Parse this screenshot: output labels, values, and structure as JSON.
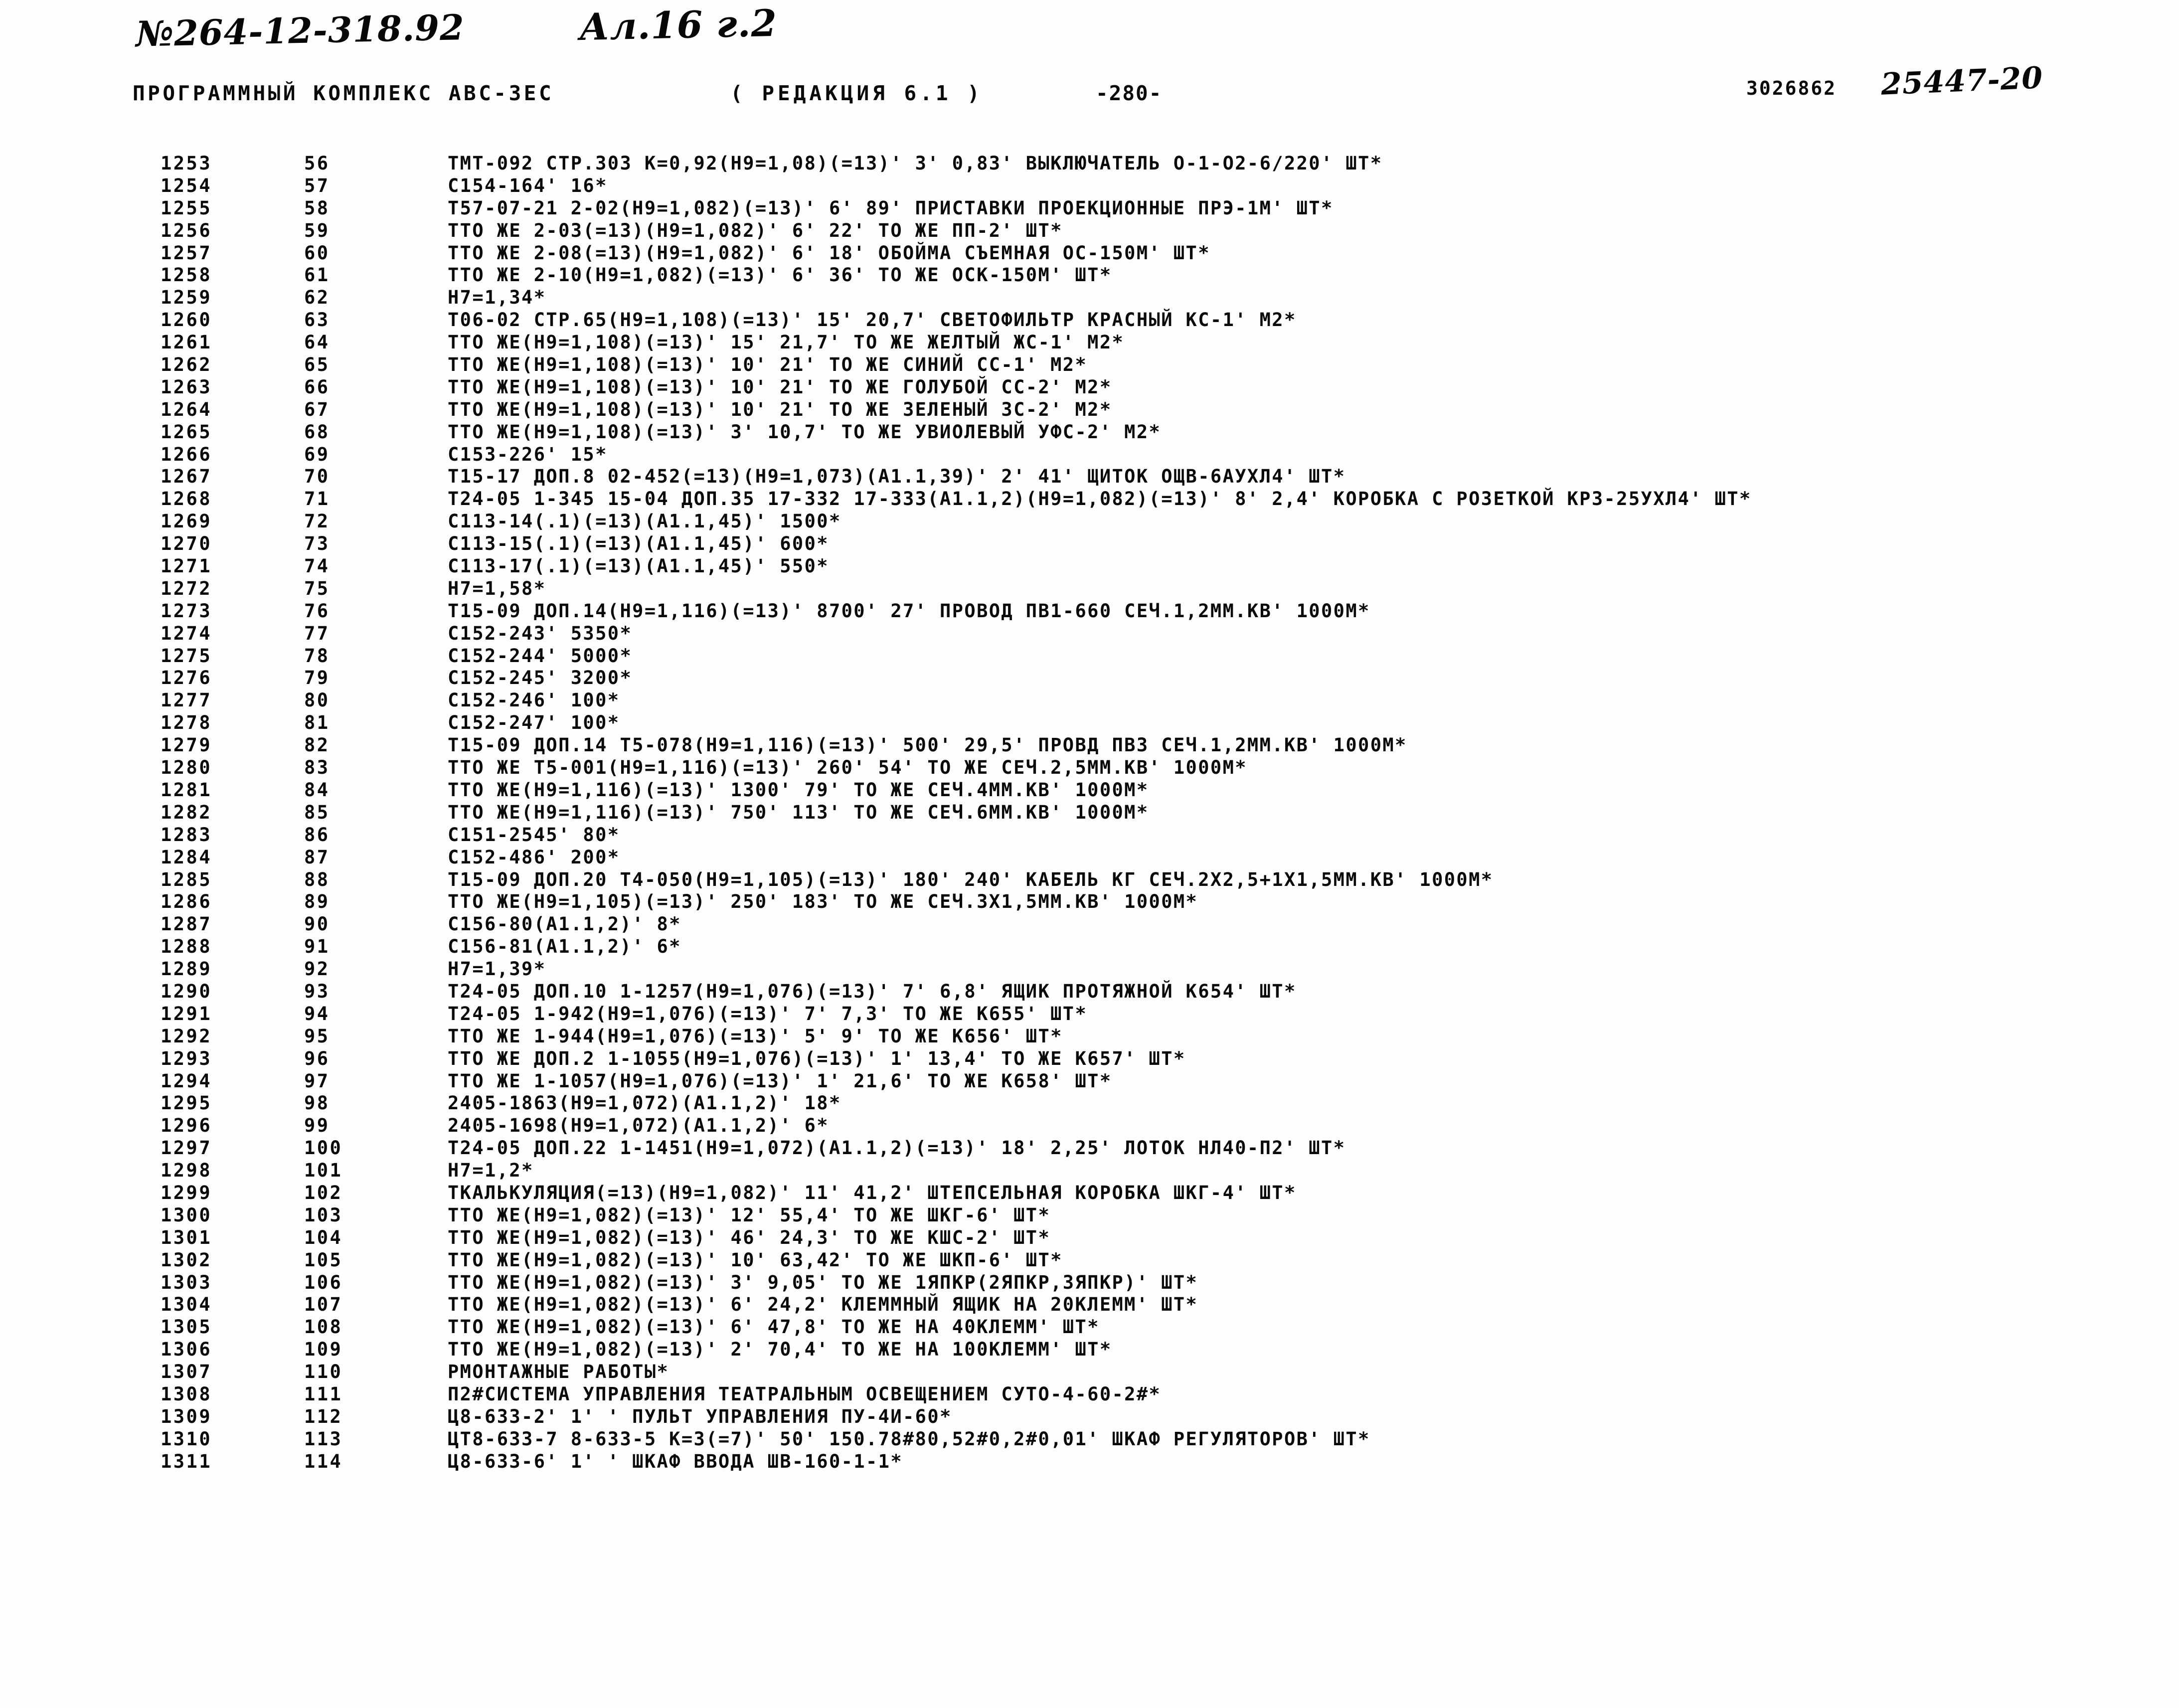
{
  "annotations": {
    "doc_number": "№264-12-318.92",
    "album_ref": "Ал.16 г.2",
    "archive_number": "25447-20"
  },
  "header": {
    "complex_title": "ПРОГРАММНЫЙ КОМПЛЕКС АВС-3ЕС",
    "revision": "( РЕДАКЦИЯ  6.1 )",
    "page_number": "-280-",
    "doc_code": "3026862"
  },
  "listing": {
    "columns": [
      "seq",
      "idx",
      "text"
    ],
    "rows": [
      [
        "1253",
        "56",
        "ТМТ-092 СТР.303 К=0,92(Н9=1,08)(=13)' 3' 0,83' ВЫКЛЮЧАТЕЛЬ О-1-О2-6/220' ШТ*"
      ],
      [
        "1254",
        "57",
        "С154-164' 16*"
      ],
      [
        "1255",
        "58",
        "Т57-07-21 2-02(Н9=1,082)(=13)' 6' 89' ПРИСТАВКИ ПРОЕКЦИОННЫЕ ПРЭ-1М' ШТ*"
      ],
      [
        "1256",
        "59",
        "ТТО ЖЕ 2-03(=13)(Н9=1,082)' 6' 22' ТО ЖЕ ПП-2' ШТ*"
      ],
      [
        "1257",
        "60",
        "ТТО ЖЕ 2-08(=13)(Н9=1,082)' 6' 18' ОБОЙМА СЪЕМНАЯ ОС-150М' ШТ*"
      ],
      [
        "1258",
        "61",
        "ТТО ЖЕ 2-10(Н9=1,082)(=13)' 6' 36' ТО ЖЕ ОСК-150М' ШТ*"
      ],
      [
        "1259",
        "62",
        "Н7=1,34*"
      ],
      [
        "1260",
        "63",
        "Т06-02 СТР.65(Н9=1,108)(=13)' 15' 20,7' СВЕТОФИЛЬТР КРАСНЫЙ КС-1' М2*"
      ],
      [
        "1261",
        "64",
        "ТТО ЖЕ(Н9=1,108)(=13)' 15' 21,7' ТО ЖЕ ЖЕЛТЫЙ ЖС-1' М2*"
      ],
      [
        "1262",
        "65",
        "ТТО ЖЕ(Н9=1,108)(=13)' 10' 21' ТО ЖЕ СИНИЙ СС-1' М2*"
      ],
      [
        "1263",
        "66",
        "ТТО ЖЕ(Н9=1,108)(=13)' 10' 21' ТО ЖЕ ГОЛУБОЙ СС-2' М2*"
      ],
      [
        "1264",
        "67",
        "ТТО ЖЕ(Н9=1,108)(=13)' 10' 21' ТО ЖЕ ЗЕЛЕНЫЙ ЗС-2' М2*"
      ],
      [
        "1265",
        "68",
        "ТТО ЖЕ(Н9=1,108)(=13)' 3' 10,7' ТО ЖЕ УВИОЛЕВЫЙ УФС-2' М2*"
      ],
      [
        "1266",
        "69",
        "С153-226' 15*"
      ],
      [
        "1267",
        "70",
        "Т15-17 ДОП.8 02-452(=13)(Н9=1,073)(А1.1,39)' 2' 41' ЩИТОК ОЩВ-6АУХЛ4' ШТ*"
      ],
      [
        "1268",
        "71",
        "Т24-05 1-345 15-04 ДОП.35 17-332 17-333(А1.1,2)(Н9=1,082)(=13)' 8' 2,4' КОРОБКА С РОЗЕТКОЙ КРЗ-25УХЛ4' ШТ*"
      ],
      [
        "1269",
        "72",
        "С113-14(.1)(=13)(А1.1,45)' 1500*"
      ],
      [
        "1270",
        "73",
        "С113-15(.1)(=13)(А1.1,45)' 600*"
      ],
      [
        "1271",
        "74",
        "С113-17(.1)(=13)(А1.1,45)' 550*"
      ],
      [
        "1272",
        "75",
        "Н7=1,58*"
      ],
      [
        "1273",
        "76",
        "Т15-09 ДОП.14(Н9=1,116)(=13)' 8700' 27' ПРОВОД ПВ1-660 СЕЧ.1,2ММ.КВ' 1000М*"
      ],
      [
        "1274",
        "77",
        "С152-243' 5350*"
      ],
      [
        "1275",
        "78",
        "С152-244' 5000*"
      ],
      [
        "1276",
        "79",
        "С152-245' 3200*"
      ],
      [
        "1277",
        "80",
        "С152-246' 100*"
      ],
      [
        "1278",
        "81",
        "С152-247' 100*"
      ],
      [
        "1279",
        "82",
        "Т15-09 ДОП.14 Т5-078(Н9=1,116)(=13)' 500' 29,5' ПРОВД ПВ3 СЕЧ.1,2ММ.КВ' 1000М*"
      ],
      [
        "1280",
        "83",
        "ТТО ЖЕ Т5-001(Н9=1,116)(=13)' 260' 54' ТО ЖЕ СЕЧ.2,5ММ.КВ' 1000М*"
      ],
      [
        "1281",
        "84",
        "ТТО ЖЕ(Н9=1,116)(=13)' 1300' 79' ТО ЖЕ СЕЧ.4ММ.КВ' 1000М*"
      ],
      [
        "1282",
        "85",
        "ТТО ЖЕ(Н9=1,116)(=13)' 750' 113' ТО ЖЕ СЕЧ.6ММ.КВ' 1000М*"
      ],
      [
        "1283",
        "86",
        "С151-2545' 80*"
      ],
      [
        "1284",
        "87",
        "С152-486' 200*"
      ],
      [
        "1285",
        "88",
        "Т15-09 ДОП.20 Т4-050(Н9=1,105)(=13)' 180' 240' КАБЕЛЬ КГ СЕЧ.2Х2,5+1Х1,5ММ.КВ' 1000М*"
      ],
      [
        "1286",
        "89",
        "ТТО ЖЕ(Н9=1,105)(=13)' 250' 183' ТО ЖЕ СЕЧ.3Х1,5ММ.КВ' 1000М*"
      ],
      [
        "1287",
        "90",
        "С156-80(А1.1,2)' 8*"
      ],
      [
        "1288",
        "91",
        "С156-81(А1.1,2)' 6*"
      ],
      [
        "1289",
        "92",
        "Н7=1,39*"
      ],
      [
        "1290",
        "93",
        "Т24-05 ДОП.10 1-1257(Н9=1,076)(=13)' 7' 6,8' ЯЩИК ПРОТЯЖНОЙ К654' ШТ*"
      ],
      [
        "1291",
        "94",
        "Т24-05 1-942(Н9=1,076)(=13)' 7' 7,3' ТО ЖЕ К655' ШТ*"
      ],
      [
        "1292",
        "95",
        "ТТО ЖЕ 1-944(Н9=1,076)(=13)' 5' 9' ТО ЖЕ К656' ШТ*"
      ],
      [
        "1293",
        "96",
        "ТТО ЖЕ ДОП.2 1-1055(Н9=1,076)(=13)' 1' 13,4' ТО ЖЕ К657' ШТ*"
      ],
      [
        "1294",
        "97",
        "ТТО ЖЕ 1-1057(Н9=1,076)(=13)' 1' 21,6' ТО ЖЕ К658' ШТ*"
      ],
      [
        "1295",
        "98",
        "2405-1863(Н9=1,072)(А1.1,2)' 18*"
      ],
      [
        "1296",
        "99",
        "2405-1698(Н9=1,072)(А1.1,2)' 6*"
      ],
      [
        "1297",
        "100",
        "Т24-05 ДОП.22 1-1451(Н9=1,072)(А1.1,2)(=13)' 18' 2,25' ЛОТОК НЛ40-П2' ШТ*"
      ],
      [
        "1298",
        "101",
        "Н7=1,2*"
      ],
      [
        "1299",
        "102",
        "ТКАЛЬКУЛЯЦИЯ(=13)(Н9=1,082)' 11' 41,2' ШТЕПСЕЛЬНАЯ КОРОБКА ШКГ-4' ШТ*"
      ],
      [
        "1300",
        "103",
        "ТТО ЖЕ(Н9=1,082)(=13)' 12' 55,4' ТО ЖЕ ШКГ-6' ШТ*"
      ],
      [
        "1301",
        "104",
        "ТТО ЖЕ(Н9=1,082)(=13)' 46' 24,3' ТО ЖЕ КШС-2' ШТ*"
      ],
      [
        "1302",
        "105",
        "ТТО ЖЕ(Н9=1,082)(=13)' 10' 63,42' ТО ЖЕ ШКП-6' ШТ*"
      ],
      [
        "1303",
        "106",
        "ТТО ЖЕ(Н9=1,082)(=13)' 3' 9,05' ТО ЖЕ 1ЯПКР(2ЯПКР,3ЯПКР)' ШТ*"
      ],
      [
        "1304",
        "107",
        "ТТО ЖЕ(Н9=1,082)(=13)' 6' 24,2' КЛЕММНЫЙ ЯЩИК НА 20КЛЕММ' ШТ*"
      ],
      [
        "1305",
        "108",
        "ТТО ЖЕ(Н9=1,082)(=13)' 6' 47,8' ТО ЖЕ НА 40КЛЕММ' ШТ*"
      ],
      [
        "1306",
        "109",
        "ТТО ЖЕ(Н9=1,082)(=13)' 2' 70,4' ТО ЖЕ НА 100КЛЕММ' ШТ*"
      ],
      [
        "1307",
        "110",
        "РМОНТАЖНЫЕ РАБОТЫ*"
      ],
      [
        "1308",
        "111",
        "П2#СИСТЕМА УПРАВЛЕНИЯ ТЕАТРАЛЬНЫМ ОСВЕЩЕНИЕМ СУТО-4-60-2#*"
      ],
      [
        "1309",
        "112",
        "Ц8-633-2' 1' ' ПУЛЬТ УПРАВЛЕНИЯ ПУ-4И-60*"
      ],
      [
        "1310",
        "113",
        "ЦТ8-633-7 8-633-5 К=3(=7)' 50' 150.78#80,52#0,2#0,01' ШКАФ РЕГУЛЯТОРОВ' ШТ*"
      ],
      [
        "1311",
        "114",
        "Ц8-633-6' 1' ' ШКАФ ВВОДА ШВ-160-1-1*"
      ]
    ]
  }
}
